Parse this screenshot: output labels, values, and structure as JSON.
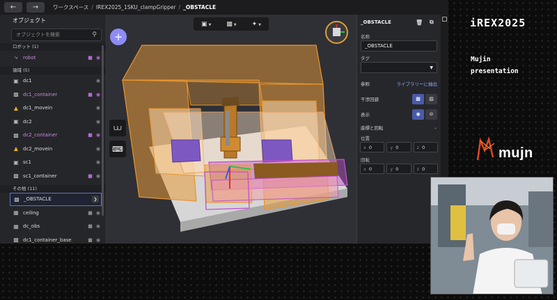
{
  "topbar": {
    "back_icon": "arrow-left-icon",
    "forward_icon": "arrow-right-icon",
    "breadcrumbs": [
      "ワークスペース",
      "IREX2025_1SKU_clampGripper",
      "_OBSTACLE"
    ]
  },
  "sidebar": {
    "title": "オブジェクト",
    "search_placeholder": "オブジェクトを検索",
    "sections": [
      {
        "label": "ロボット (1)",
        "items": [
          {
            "label": "robot",
            "icon": "robot-arm-icon",
            "purple": true
          }
        ]
      },
      {
        "label": "領域 (5)",
        "items": [
          {
            "label": "dc1",
            "icon": "container-icon",
            "purple": false
          },
          {
            "label": "dc1_container",
            "icon": "cube-icon",
            "purple": true
          },
          {
            "label": "dc1_movein",
            "icon": "warning-icon",
            "purple": false
          },
          {
            "label": "dc2",
            "icon": "container-icon",
            "purple": false
          },
          {
            "label": "dc2_container",
            "icon": "cube-icon",
            "purple": true
          },
          {
            "label": "dc2_movein",
            "icon": "warning-icon",
            "purple": false
          },
          {
            "label": "sc1",
            "icon": "container-icon",
            "purple": false
          },
          {
            "label": "sc1_container",
            "icon": "cube-icon",
            "purple": false
          }
        ]
      },
      {
        "label": "その他 (11)",
        "items": [
          {
            "label": "_OBSTACLE",
            "icon": "cube-icon",
            "selected": true
          },
          {
            "label": "ceiling",
            "icon": "grid-icon"
          },
          {
            "label": "dc_obs",
            "icon": "grid-icon"
          },
          {
            "label": "dc1_container_base",
            "icon": "cube-icon"
          }
        ]
      }
    ]
  },
  "viewport": {
    "toolbar_icons": [
      "view-cube-icon",
      "box-display-icon",
      "camera-mode-icon"
    ],
    "add_icon": "plus-icon",
    "side_icons": [
      "axes-icon",
      "keyboard-icon"
    ],
    "gizmo_icon": "orientation-gizmo-icon"
  },
  "properties": {
    "title": "_OBSTACLE",
    "name_label": "名称",
    "name_value": "_OBSTACLE",
    "tag_label": "タグ",
    "reference_label": "参照",
    "reference_link": "ライブラリーに抽出",
    "collision_label": "干渉回避",
    "display_label": "表示",
    "transform_label": "座標と回転",
    "position_label": "位置",
    "rotation_label": "回転",
    "position": {
      "x": "0",
      "y": "0",
      "z": "0"
    },
    "rotation": {
      "x": "0",
      "y": "0",
      "z": "0"
    },
    "axis_x": "x",
    "axis_y": "y",
    "axis_z": "z"
  },
  "branding": {
    "title": "iREX2025",
    "subtitle_line1": "Mujin",
    "subtitle_line2": "presentation",
    "logo_word": "mujn",
    "logo_color": "#e0481e"
  },
  "colors": {
    "accent": "#8f8bf5",
    "obstacle_orange": "#e89a3a",
    "container_purple": "#c24fd1",
    "robot_highlight": "#c58bdc"
  }
}
